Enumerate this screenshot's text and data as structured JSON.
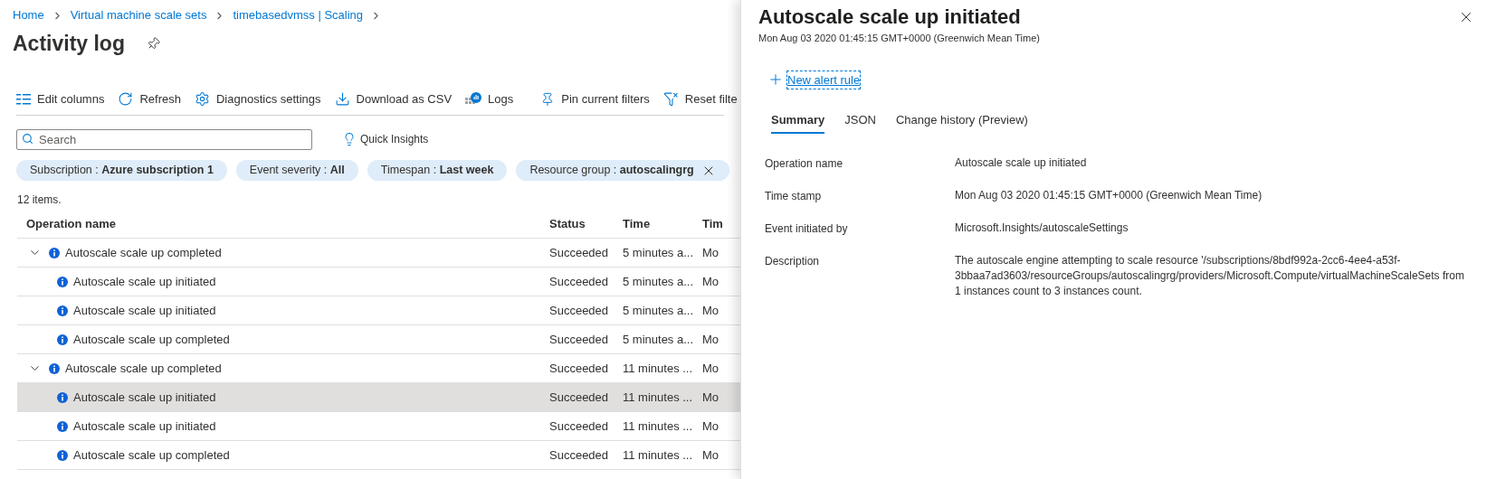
{
  "breadcrumb": [
    "Home",
    "Virtual machine scale sets",
    "timebasedvmss | Scaling"
  ],
  "page_title": "Activity log",
  "toolbar": [
    {
      "label": "Edit columns",
      "kind": "columns"
    },
    {
      "label": "Refresh",
      "kind": "refresh"
    },
    {
      "label": "Diagnostics settings",
      "kind": "settings"
    },
    {
      "label": "Download as CSV",
      "kind": "download"
    },
    {
      "label": "Logs",
      "kind": "logs"
    },
    {
      "label": "Pin current filters",
      "kind": "pin"
    },
    {
      "label": "Reset filte",
      "kind": "filter"
    }
  ],
  "search": {
    "placeholder": "Search"
  },
  "quick_insights": "Quick Insights",
  "filters": [
    {
      "label": "Subscription : ",
      "value": "Azure subscription 1",
      "removable": false
    },
    {
      "label": "Event severity : ",
      "value": "All",
      "removable": false
    },
    {
      "label": "Timespan : ",
      "value": "Last week",
      "removable": false
    },
    {
      "label": "Resource group : ",
      "value": "autoscalingrg",
      "removable": true
    }
  ],
  "item_count": "12 items.",
  "table": {
    "columns": [
      "Operation name",
      "Status",
      "Time",
      "Tim"
    ],
    "rows": [
      {
        "name": "Autoscale scale up completed",
        "status": "Succeeded",
        "time": "5 minutes a...",
        "column_4": "Mo",
        "expanded": true,
        "selected": false,
        "children": [
          {
            "name": "Autoscale scale up initiated",
            "status": "Succeeded",
            "time": "5 minutes a...",
            "column_4": "Mo",
            "selected": false
          },
          {
            "name": "Autoscale scale up initiated",
            "status": "Succeeded",
            "time": "5 minutes a...",
            "column_4": "Mo",
            "selected": false
          },
          {
            "name": "Autoscale scale up completed",
            "status": "Succeeded",
            "time": "5 minutes a...",
            "column_4": "Mo",
            "selected": false
          }
        ]
      },
      {
        "name": "Autoscale scale up completed",
        "status": "Succeeded",
        "time": "11 minutes ...",
        "column_4": "Mo",
        "expanded": true,
        "selected": false,
        "children": [
          {
            "name": "Autoscale scale up initiated",
            "status": "Succeeded",
            "time": "11 minutes ...",
            "column_4": "Mo",
            "selected": true
          },
          {
            "name": "Autoscale scale up initiated",
            "status": "Succeeded",
            "time": "11 minutes ...",
            "column_4": "Mo",
            "selected": false
          },
          {
            "name": "Autoscale scale up completed",
            "status": "Succeeded",
            "time": "11 minutes ...",
            "column_4": "Mo",
            "selected": false
          }
        ]
      }
    ]
  },
  "panel": {
    "title": "Autoscale scale up initiated",
    "subtitle": "Mon Aug 03 2020 01:45:15 GMT+0000 (Greenwich Mean Time)",
    "new_alert_rule": "New alert rule",
    "tabs": [
      {
        "label": "Summary",
        "selected": true
      },
      {
        "label": "JSON",
        "selected": false
      },
      {
        "label": "Change history (Preview)",
        "selected": false
      }
    ],
    "details": [
      {
        "label": "Operation name",
        "value": "Autoscale scale up initiated"
      },
      {
        "label": "Time stamp",
        "value": "Mon Aug 03 2020 01:45:15 GMT+0000 (Greenwich Mean Time)"
      },
      {
        "label": "Event initiated by",
        "value": "Microsoft.Insights/autoscaleSettings"
      },
      {
        "label": "Description",
        "value": "The autoscale engine attempting to scale resource '/subscriptions/8bdf992a-2cc6-4ee4-a53f-3bbaa7ad3603/resourceGroups/autoscalingrg/providers/Microsoft.Compute/virtualMachineScaleSets from 1 instances count to 3 instances count."
      }
    ]
  }
}
